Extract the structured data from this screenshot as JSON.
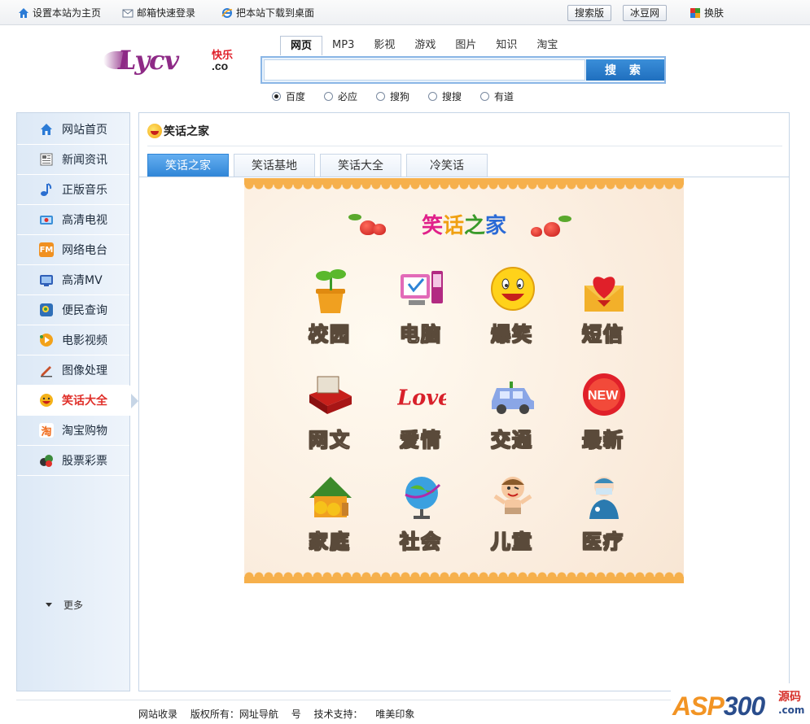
{
  "topbar": {
    "set_home": "设置本站为主页",
    "mail_login": "邮箱快速登录",
    "download_desktop": "把本站下载到桌面",
    "search_edition": "搜索版",
    "bingdou": "冰豆网",
    "skin": "换肤"
  },
  "logo": {
    "word": "Lycv",
    "kuai": "快乐",
    "co": ".co"
  },
  "search": {
    "tabs": [
      "网页",
      "MP3",
      "影视",
      "游戏",
      "图片",
      "知识",
      "淘宝"
    ],
    "active_tab": "网页",
    "query": "",
    "button": "搜 索",
    "engines": [
      "百度",
      "必应",
      "搜狗",
      "搜搜",
      "有道"
    ],
    "selected_engine": "百度"
  },
  "sidebar": {
    "items": [
      {
        "label": "网站首页",
        "icon": "home-icon",
        "color": "#2b7bd6"
      },
      {
        "label": "新闻资讯",
        "icon": "news-icon",
        "color": "#6b6b6b"
      },
      {
        "label": "正版音乐",
        "icon": "music-note-icon",
        "color": "#2b6fd0"
      },
      {
        "label": "高清电视",
        "icon": "tv-icon",
        "color": "#3a8fd8"
      },
      {
        "label": "网络电台",
        "icon": "radio-fm-icon",
        "color": "#f09020"
      },
      {
        "label": "高清MV",
        "icon": "mv-icon",
        "color": "#2f5fb8"
      },
      {
        "label": "便民查询",
        "icon": "query-icon",
        "color": "#3c9a3c"
      },
      {
        "label": "电影视频",
        "icon": "movie-icon",
        "color": "#f2a21a"
      },
      {
        "label": "图像处理",
        "icon": "pen-icon",
        "color": "#c8502a"
      },
      {
        "label": "笑话大全",
        "icon": "laugh-face-icon",
        "color": "#f2a21a"
      },
      {
        "label": "淘宝购物",
        "icon": "taobao-icon",
        "color": "#f06a1a"
      },
      {
        "label": "股票彩票",
        "icon": "lottery-icon",
        "color": "#3a8a3a"
      }
    ],
    "active": "笑话大全",
    "more": "更多"
  },
  "main": {
    "heading": "笑话之家",
    "tabs": [
      "笑话之家",
      "笑话基地",
      "笑话大全",
      "冷笑话"
    ],
    "active_tab": "笑话之家"
  },
  "card": {
    "title_chars": [
      {
        "c": "笑",
        "color": "#e0208a"
      },
      {
        "c": "话",
        "color": "#f0a010"
      },
      {
        "c": "之",
        "color": "#3a9a2a"
      },
      {
        "c": "家",
        "color": "#2a6ad6"
      }
    ],
    "categories": [
      {
        "label": "校园",
        "icon": "sprout-pot-icon"
      },
      {
        "label": "电脑",
        "icon": "computer-icon"
      },
      {
        "label": "爆笑",
        "icon": "smiley-icon"
      },
      {
        "label": "短信",
        "icon": "heart-envelope-icon"
      },
      {
        "label": "网文",
        "icon": "book-icon"
      },
      {
        "label": "爱情",
        "icon": "love-text-icon"
      },
      {
        "label": "交通",
        "icon": "car-icon"
      },
      {
        "label": "最新",
        "icon": "new-badge-icon"
      },
      {
        "label": "家庭",
        "icon": "house-icon"
      },
      {
        "label": "社会",
        "icon": "globe-icon"
      },
      {
        "label": "儿童",
        "icon": "child-icon"
      },
      {
        "label": "医疗",
        "icon": "doctor-icon"
      }
    ]
  },
  "footer": {
    "items": [
      "网站收录",
      "版权所有：网址导航",
      "号",
      "技术支持：",
      "唯美印象"
    ]
  },
  "watermark": {
    "asp": "ASP",
    "num": "300",
    "ym": "源码",
    "com": ".com"
  }
}
